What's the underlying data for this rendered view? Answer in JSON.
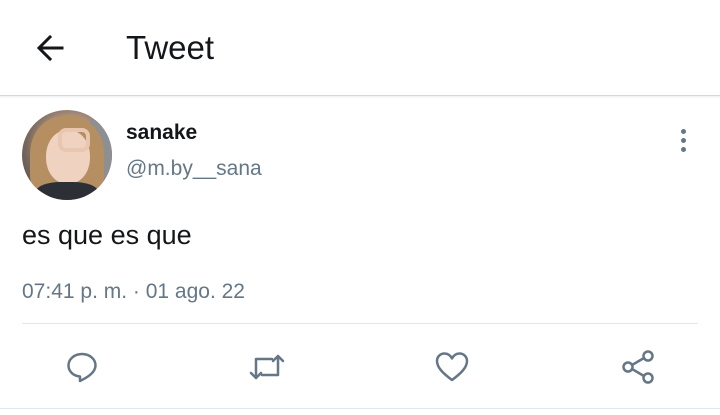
{
  "header": {
    "title": "Tweet",
    "back_icon": "arrow-left-icon"
  },
  "tweet": {
    "display_name": "sanake",
    "handle": "@m.by__sana",
    "text": "es que es que",
    "timestamp": "07:41 p. m. · 01 ago. 22",
    "more_icon": "more-vertical-icon"
  },
  "actions": [
    {
      "name": "reply",
      "icon": "reply-icon"
    },
    {
      "name": "retweet",
      "icon": "retweet-icon"
    },
    {
      "name": "like",
      "icon": "heart-icon"
    },
    {
      "name": "share",
      "icon": "share-icon"
    }
  ],
  "colors": {
    "text_primary": "#14171a",
    "text_secondary": "#657786",
    "divider": "#e1e8ed"
  }
}
